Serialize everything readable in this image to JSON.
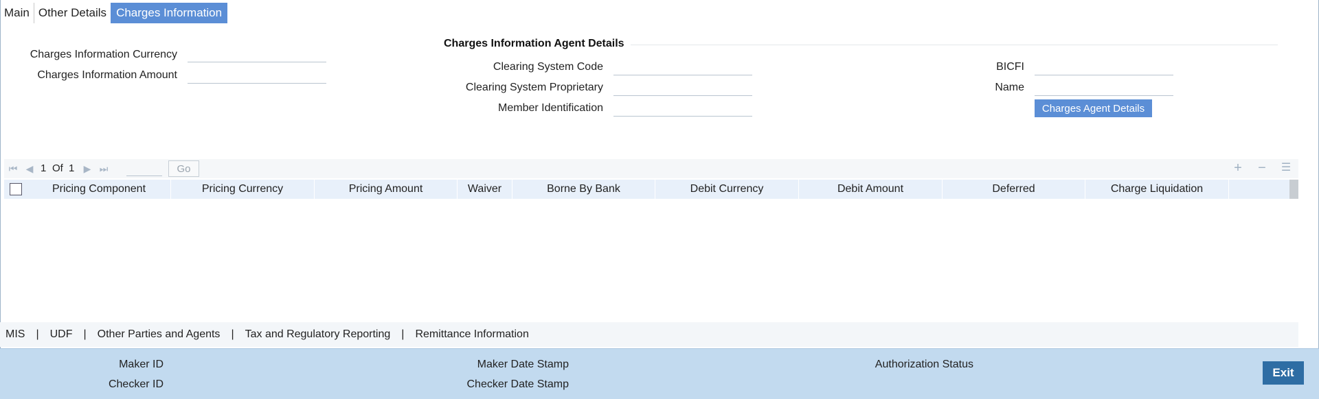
{
  "tabs": [
    {
      "label": "Main"
    },
    {
      "label": "Other Details"
    },
    {
      "label": "Charges Information"
    }
  ],
  "charges_info": {
    "currency_label": "Charges Information Currency",
    "currency_value": "",
    "amount_label": "Charges Information Amount",
    "amount_value": ""
  },
  "agent_details": {
    "section_title": "Charges Information Agent Details",
    "clearing_system_code_label": "Clearing System Code",
    "clearing_system_code_value": "",
    "clearing_system_proprietary_label": "Clearing System Proprietary",
    "clearing_system_proprietary_value": "",
    "member_identification_label": "Member Identification",
    "member_identification_value": "",
    "bicfi_label": "BICFI",
    "bicfi_value": "",
    "name_label": "Name",
    "name_value": "",
    "agent_button_label": "Charges Agent Details"
  },
  "grid": {
    "page_current": "1",
    "page_of": "Of",
    "page_total": "1",
    "go_label": "Go",
    "columns": [
      "Pricing Component",
      "Pricing Currency",
      "Pricing Amount",
      "Waiver",
      "Borne By Bank",
      "Debit Currency",
      "Debit Amount",
      "Deferred",
      "Charge Liquidation"
    ],
    "rows": []
  },
  "bottom_links": [
    "MIS",
    "UDF",
    "Other Parties and Agents",
    "Tax and Regulatory Reporting",
    "Remittance Information"
  ],
  "footer": {
    "maker_id_label": "Maker ID",
    "checker_id_label": "Checker ID",
    "maker_date_label": "Maker Date Stamp",
    "checker_date_label": "Checker Date Stamp",
    "auth_status_label": "Authorization Status",
    "exit_label": "Exit"
  },
  "colors": {
    "tab_active": "#5b8ed6",
    "grid_header": "#e8f0fa",
    "footer_bg": "#c2daef",
    "exit_button": "#2e6da4"
  }
}
